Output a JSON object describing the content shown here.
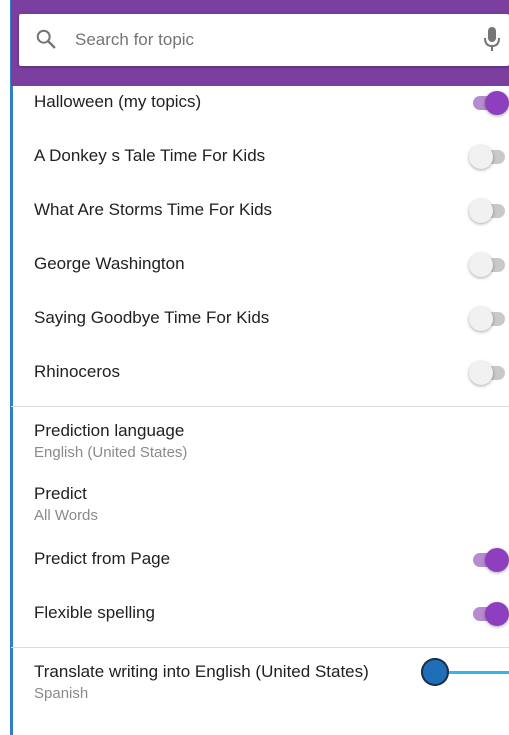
{
  "search": {
    "placeholder": "Search for topic",
    "icon": "search-icon",
    "mic_icon": "mic-icon"
  },
  "topics": [
    {
      "label": "Halloween (my topics)",
      "enabled": true
    },
    {
      "label": "A Donkey s Tale Time For Kids",
      "enabled": false
    },
    {
      "label": "What Are Storms Time For Kids",
      "enabled": false
    },
    {
      "label": "George Washington",
      "enabled": false
    },
    {
      "label": "Saying Goodbye Time For Kids",
      "enabled": false
    },
    {
      "label": "Rhinoceros",
      "enabled": false
    }
  ],
  "settings": {
    "prediction_language": {
      "title": "Prediction language",
      "value": "English (United States)"
    },
    "predict": {
      "title": "Predict",
      "value": "All Words"
    },
    "predict_from_page": {
      "label": "Predict from Page",
      "enabled": true
    },
    "flexible_spelling": {
      "label": "Flexible spelling",
      "enabled": true
    },
    "translate": {
      "title": "Translate writing into English (United States)",
      "value": "Spanish"
    }
  },
  "colors": {
    "accent": "#8e3fbf",
    "header_bar": "#7b3fa0",
    "slider": "#35b6e8",
    "slider_knob": "#1f6fb8",
    "left_border": "#2f80c8"
  }
}
